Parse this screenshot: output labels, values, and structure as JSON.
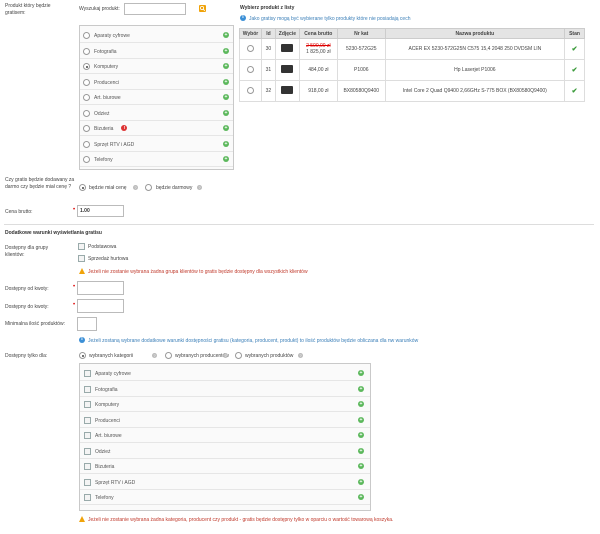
{
  "product_section": {
    "label": "Produkt który będzie gratisem:",
    "search_label": "Wyszukaj produkt:",
    "search_value": "",
    "categories": [
      {
        "label": "Aparaty cyfrowe",
        "selected": false
      },
      {
        "label": "Fotografia",
        "selected": false
      },
      {
        "label": "Komputery",
        "selected": true
      },
      {
        "label": "Producenci",
        "selected": false
      },
      {
        "label": "Art. biurowe",
        "selected": false
      },
      {
        "label": "Odzież",
        "selected": false
      },
      {
        "label": "Bizuteria",
        "selected": false,
        "badge": "!"
      },
      {
        "label": "Sprzęt RTV i AGD",
        "selected": false
      },
      {
        "label": "Telefony",
        "selected": false
      }
    ]
  },
  "product_list": {
    "title": "Wybierz produkt z listy",
    "info": "Jako gratisy mogą być wybierane tylko produkty które nie posiadają cech",
    "headers": [
      "Wybór",
      "Id",
      "Zdjęcie",
      "Cena brutto",
      "Nr kat",
      "Nazwa produktu",
      "Stan"
    ],
    "rows": [
      {
        "id": "30",
        "old_price": "2 500,00 zł",
        "price": "1 825,00 zł",
        "cat": "5230-572G25",
        "name": "ACER EX 5230-572G25N C575 15,4 2048 250 DVDSM LIN"
      },
      {
        "id": "31",
        "old_price": "",
        "price": "484,00 zł",
        "cat": "P1006",
        "name": "Hp Laserjet P1006"
      },
      {
        "id": "32",
        "old_price": "",
        "price": "918,00 zł",
        "cat": "BX80580Q9400",
        "name": "Intel Core 2 Quad Q9400 2,66GHz S-775 BOX (BX80580Q9400)"
      }
    ]
  },
  "gift_mode": {
    "label": "Czy gratis będzie dodawany za darmo czy będzie miał cenę ?",
    "option_price": "będzie miał cenę",
    "option_free": "będzie darmowy"
  },
  "price": {
    "label": "Cena brutto:",
    "value": "1.00"
  },
  "conditions": {
    "title": "Dodatkowe warunki wyświetlania gratisu",
    "groups_label": "Dostępny dla grupy klientów:",
    "groups": [
      "Podstawowa",
      "Sprzedaż hurtowa"
    ],
    "groups_warning": "Jeżeli nie zostanie wybrana żadna grupa klientów to gratis będzie dostępny dla wszystkich klientów",
    "from_label": "Dostępny od kwoty:",
    "to_label": "Dostępny do kwoty:",
    "min_qty_label": "Minimalna ilość produktów:",
    "info": "Jeżeli zostaną wybrane dodatkowe warunki dostępności gratisu (kategoria, producent, produkt) to ilość produktów będzie obliczana dla nw warunków",
    "only_for_label": "Dostępny tylko dla:",
    "only_for_options": [
      "wybranych kategorii",
      "wybranych producentów",
      "wybranych produktów"
    ],
    "categories": [
      "Aparaty cyfrowe",
      "Fotografia",
      "Komputery",
      "Producenci",
      "Art. biurowe",
      "Odzież",
      "Bizuteria",
      "Sprzęt RTV i AGD",
      "Telefony"
    ],
    "bottom_warning": "Jeżeli nie zostanie wybrana żadna kategoria, producent czy produkt - gratis będzie dostępny tylko w oparciu o wartość towarową koszyka."
  },
  "colors": {
    "accent_green": "#5cb85c",
    "info_blue": "#3b8fd6",
    "warn_orange": "#f0a30a",
    "warn_text": "#c0392b",
    "required_red": "#d00"
  }
}
